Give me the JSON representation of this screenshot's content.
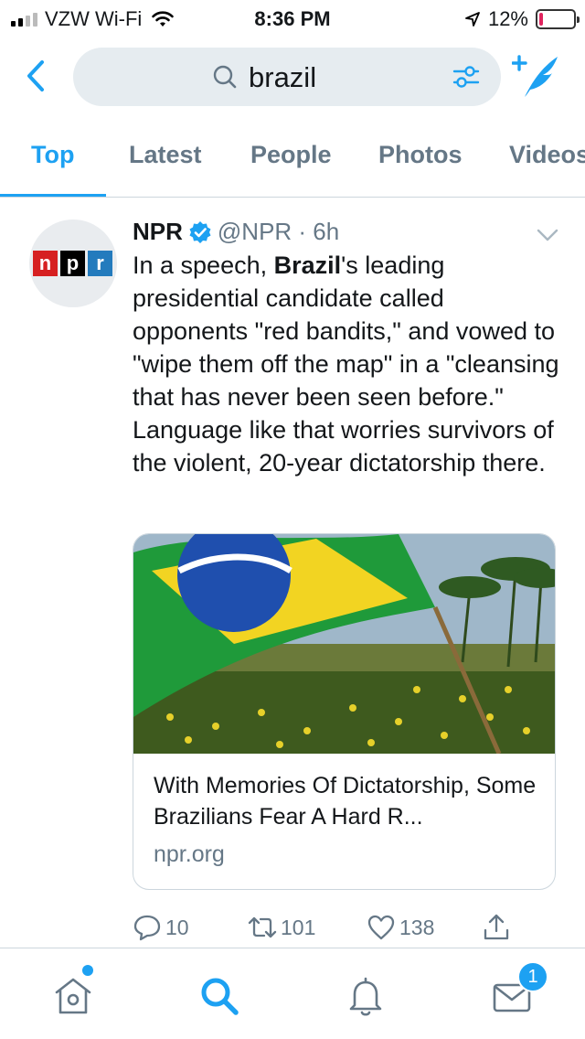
{
  "status_bar": {
    "carrier": "VZW Wi-Fi",
    "time": "8:36 PM",
    "battery": "12%",
    "battery_level": 0.12,
    "icons": [
      "signal-icon",
      "wifi-icon",
      "location-arrow-icon",
      "battery-icon"
    ]
  },
  "search": {
    "query": "brazil",
    "icons": [
      "back-chevron-icon",
      "search-icon",
      "filter-sliders-icon",
      "compose-tweet-icon"
    ]
  },
  "tabs": [
    "Top",
    "Latest",
    "People",
    "Photos",
    "Videos"
  ],
  "active_tab": "Top",
  "tweet": {
    "name": "NPR",
    "handle_time": "@NPR · 6h",
    "avatar_logo": [
      "n",
      "p",
      "r"
    ],
    "text_before": "In a speech, ",
    "text_bold": "Brazil",
    "text_after": "'s leading presidential candidate called opponents \"red bandits,\" and vowed to \"wipe them off the map\" in a \"cleansing that has never been seen before.\" Language like that worries survivors of the violent, 20-year dictatorship there.",
    "card": {
      "title": "With Memories Of Dictatorship, Some Brazilians Fear A Hard R...",
      "domain": "npr.org"
    },
    "actions": {
      "replies": "10",
      "retweets": "101",
      "likes": "138"
    }
  },
  "bottom_nav": {
    "items": [
      "home-icon",
      "search-icon",
      "notifications-icon",
      "messages-icon"
    ],
    "messages_badge": "1"
  },
  "colors": {
    "accent": "#1da1f2",
    "secondary_text": "#657786",
    "divider": "#ccd6dd",
    "search_bg": "#e6ecf0",
    "battery_low": "#e0245e"
  }
}
